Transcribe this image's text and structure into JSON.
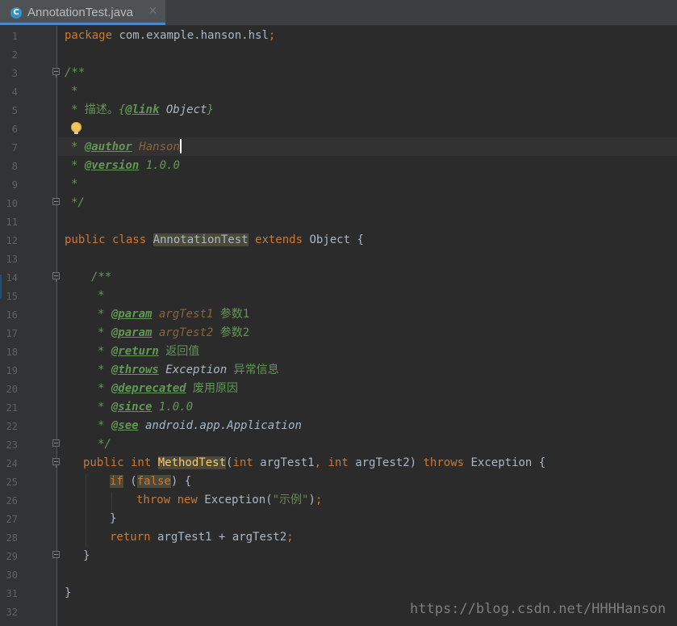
{
  "tab": {
    "file_name": "AnnotationTest.java",
    "icon_letter": "C",
    "close_glyph": "×"
  },
  "gutter": {
    "line_numbers": [
      "1",
      "2",
      "3",
      "4",
      "5",
      "6",
      "7",
      "8",
      "9",
      "10",
      "11",
      "12",
      "13",
      "14",
      "15",
      "16",
      "17",
      "18",
      "19",
      "20",
      "21",
      "22",
      "23",
      "24",
      "25",
      "26",
      "27",
      "28",
      "29",
      "30",
      "31",
      "32"
    ]
  },
  "code": {
    "l1": [
      "package",
      " com.example.hanson.hsl",
      ";"
    ],
    "l3": "/**",
    "l4": "*",
    "l5": [
      "* ",
      "描述。",
      "{",
      "@link",
      " Object",
      "}"
    ],
    "l7": [
      "* ",
      "@author",
      " Hanson"
    ],
    "l8": [
      "* ",
      "@version",
      " 1.0.0"
    ],
    "l9": "*",
    "l10": "*/",
    "l12": [
      "public class ",
      "AnnotationTest",
      " extends ",
      "Object {"
    ],
    "l14": "/**",
    "l15": "*",
    "l16": [
      "* ",
      "@param",
      " argTest1",
      " 参数1"
    ],
    "l17": [
      "* ",
      "@param",
      " argTest2",
      " 参数2"
    ],
    "l18": [
      "* ",
      "@return",
      " 返回值"
    ],
    "l19": [
      "* ",
      "@throws",
      " Exception",
      " 异常信息"
    ],
    "l20": [
      "* ",
      "@deprecated",
      " 废用原因"
    ],
    "l21": [
      "* ",
      "@since",
      " 1.0.0"
    ],
    "l22": [
      "* ",
      "@see",
      " android.app.Application"
    ],
    "l23": "*/",
    "l24": [
      "public int ",
      "MethodTest",
      "(",
      "int",
      " argTest1",
      ", ",
      "int",
      " argTest2)",
      " throws",
      " Exception {"
    ],
    "l25": [
      "if",
      " (",
      "false",
      ")",
      " {"
    ],
    "l26": [
      "throw new",
      " Exception(",
      "\"示例\"",
      ")",
      ";"
    ],
    "l27": "}",
    "l28": [
      "return",
      " argTest1 + argTest2",
      ";"
    ],
    "l29": "}",
    "l31": "}"
  },
  "watermark": "https://blog.csdn.net/HHHHanson",
  "colors": {
    "keyword": "#cc7832",
    "doc_comment": "#629755",
    "text": "#a9b7c6",
    "background": "#2b2b2b",
    "gutter": "#313335"
  }
}
